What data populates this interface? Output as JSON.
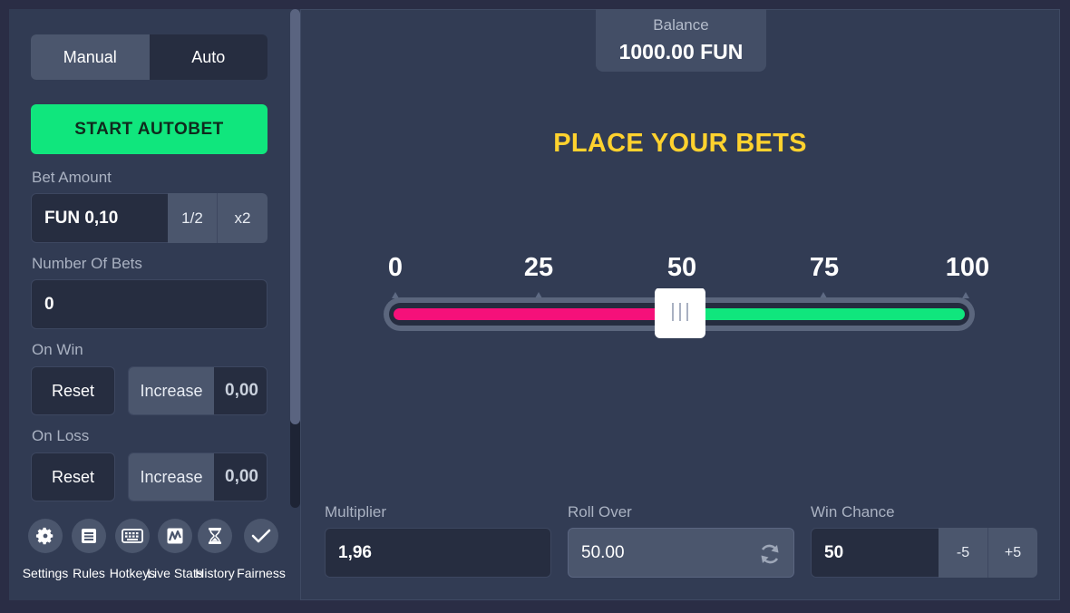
{
  "sidebar": {
    "mode_tabs": [
      {
        "label": "Manual",
        "active": true
      },
      {
        "label": "Auto",
        "active": false
      }
    ],
    "start_button": "START AUTOBET",
    "bet_amount": {
      "label": "Bet Amount",
      "value": "FUN 0,10",
      "half": "1/2",
      "double": "x2"
    },
    "number_of_bets": {
      "label": "Number Of Bets",
      "value": "0"
    },
    "on_win": {
      "label": "On Win",
      "reset": "Reset",
      "increase": "Increase",
      "value": "0,00"
    },
    "on_loss": {
      "label": "On Loss",
      "reset": "Reset",
      "increase": "Increase",
      "value": "0,00"
    },
    "footer": [
      {
        "label": "Settings",
        "icon": "gear-icon"
      },
      {
        "label": "Rules",
        "icon": "rules-icon"
      },
      {
        "label": "Hotkeys",
        "icon": "keyboard-icon"
      },
      {
        "label": "Live Stats",
        "icon": "live-stats-icon"
      },
      {
        "label": "History",
        "icon": "hourglass-icon"
      },
      {
        "label": "Fairness",
        "icon": "checkmark-icon"
      }
    ]
  },
  "balance": {
    "label": "Balance",
    "value": "1000.00 FUN"
  },
  "headline": "PLACE YOUR BETS",
  "slider": {
    "ticks": [
      "0",
      "25",
      "50",
      "75",
      "100"
    ],
    "value": 50,
    "colors": {
      "lose": "#f5117a",
      "win": "#10e67d"
    }
  },
  "controls": {
    "multiplier": {
      "label": "Multiplier",
      "value": "1,96"
    },
    "roll_over": {
      "label": "Roll Over",
      "value": "50.00"
    },
    "win_chance": {
      "label": "Win Chance",
      "value": "50",
      "minus": "-5",
      "plus": "+5"
    }
  },
  "colors": {
    "accent": "#10e67d",
    "headline": "#ffd22e"
  }
}
